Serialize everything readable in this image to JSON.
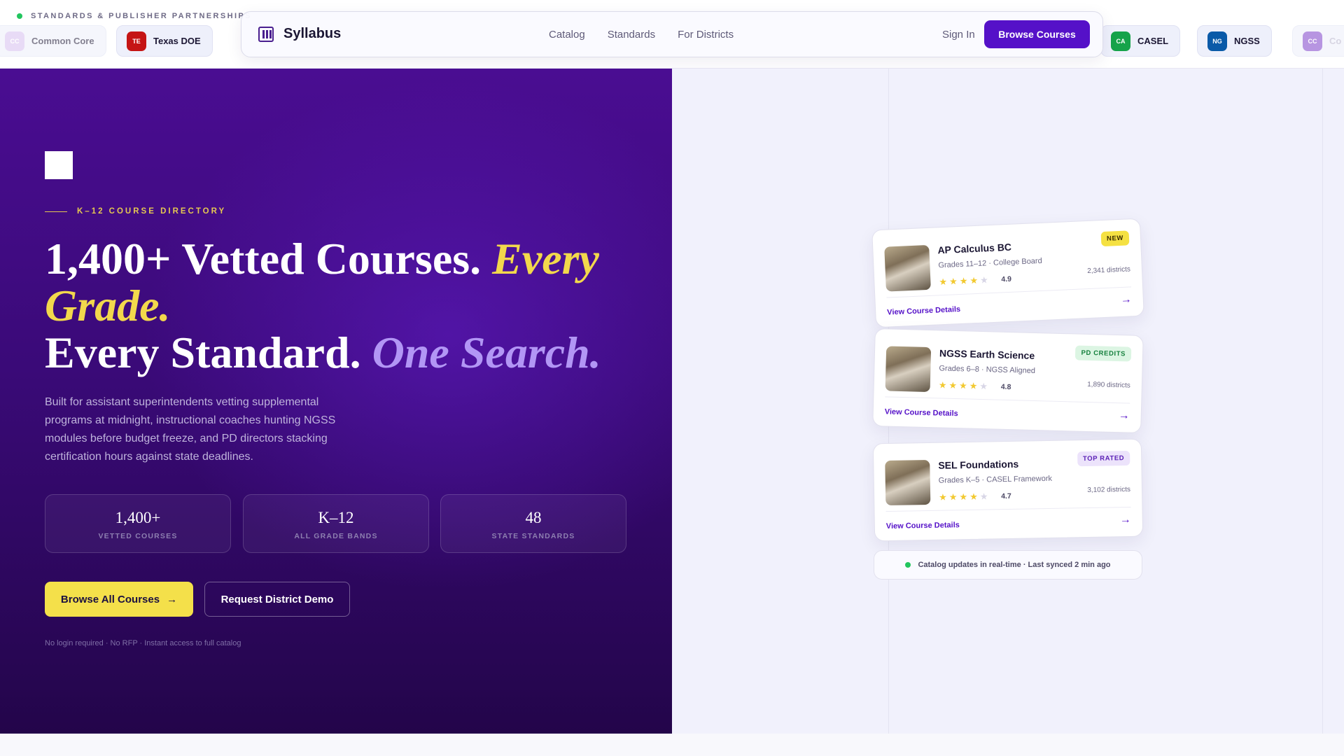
{
  "strip": {
    "label": "STANDARDS & PUBLISHER PARTNERSHIPS",
    "partners": [
      {
        "abbr": "CC",
        "name": "Common Core",
        "color": "#b48ae0"
      },
      {
        "abbr": "TE",
        "name": "Texas DOE",
        "color": "#c51414"
      },
      {
        "abbr": "CA",
        "name": "CASEL",
        "color": "#16a34a"
      },
      {
        "abbr": "NG",
        "name": "NGSS",
        "color": "#0a5aa8"
      },
      {
        "abbr": "CC",
        "name": "Co",
        "color": "#7e3fc9"
      }
    ]
  },
  "nav": {
    "brand": "Syllabus",
    "links": [
      "Catalog",
      "Standards",
      "For Districts"
    ],
    "signin": "Sign In",
    "cta": "Browse Courses"
  },
  "hero": {
    "eyebrow": "K–12 COURSE DIRECTORY",
    "headline": {
      "part1": "1,400+ Vetted Courses.",
      "part2": "Every Grade.",
      "part3": "Every Standard.",
      "part4": "One Search."
    },
    "description": "Built for assistant superintendents vetting supplemental programs at midnight, instructional coaches hunting NGSS modules before budget freeze, and PD directors stacking certification hours against state deadlines.",
    "stats": [
      {
        "value": "1,400+",
        "label": "VETTED COURSES"
      },
      {
        "value": "K–12",
        "label": "ALL GRADE BANDS"
      },
      {
        "value": "48",
        "label": "STATE STANDARDS"
      }
    ],
    "cta_primary": "Browse All Courses",
    "cta_primary_arrow": "→",
    "cta_secondary": "Request District Demo",
    "fine_print": "No login required · No RFP · Instant access to full catalog"
  },
  "courses": [
    {
      "title": "AP Calculus BC",
      "subtitle": "Grades 11–12 · College Board",
      "rating": "4.9",
      "stars": 4,
      "districts": "2,341 districts",
      "badge": "NEW",
      "badge_bg": "#f5e142",
      "badge_fg": "#3a2c00",
      "link": "View Course Details",
      "arrow": "→"
    },
    {
      "title": "NGSS Earth Science",
      "subtitle": "Grades 6–8 · NGSS Aligned",
      "rating": "4.8",
      "stars": 4,
      "districts": "1,890 districts",
      "badge": "PD CREDITS",
      "badge_bg": "#dcf5e3",
      "badge_fg": "#15803d",
      "link": "View Course Details",
      "arrow": "→"
    },
    {
      "title": "SEL Foundations",
      "subtitle": "Grades K–5 · CASEL Framework",
      "rating": "4.7",
      "stars": 4,
      "districts": "3,102 districts",
      "badge": "TOP RATED",
      "badge_bg": "#ece3fb",
      "badge_fg": "#5b21b6",
      "link": "View Course Details",
      "arrow": "→"
    }
  ],
  "status": "Catalog updates in real-time · Last synced 2 min ago"
}
